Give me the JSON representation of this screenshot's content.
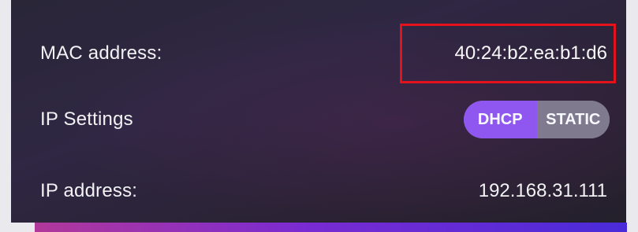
{
  "network_panel": {
    "mac": {
      "label": "MAC address:",
      "value": "40:24:b2:ea:b1:d6"
    },
    "ip_settings": {
      "label": "IP Settings",
      "options": {
        "dhcp": "DHCP",
        "static": "STATIC"
      },
      "selected": "DHCP"
    },
    "ip_address": {
      "label": "IP address:",
      "value": "192.168.31.111"
    }
  },
  "colors": {
    "panel_bg": "#2b2639",
    "highlight_border": "#e3121b",
    "toggle_selected": "#8f57f0",
    "toggle_unselected": "#7f7a8d",
    "accent_bar": "#7a2bd1"
  }
}
